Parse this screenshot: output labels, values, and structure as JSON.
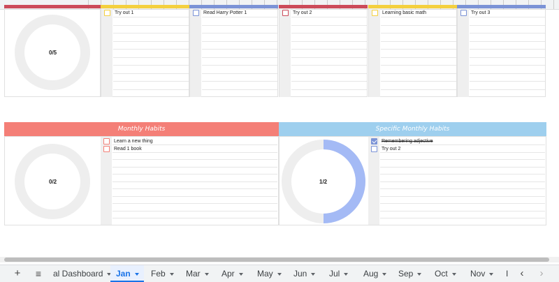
{
  "colors": {
    "red": "#cc4b5a",
    "yellow": "#f4d03f",
    "blue": "#7b93d6",
    "salmon": "#f47f77",
    "lightblue": "#9ecfee",
    "donut_track": "#eeeeee",
    "donut_fill": "#a4baf5"
  },
  "top_section": {
    "progress_label": "0/5",
    "lists": [
      {
        "item": "Try out 1",
        "color": "yellow"
      },
      {
        "item": "Read Harry Potter 1",
        "color": "blue"
      },
      {
        "item": "Try out 2",
        "color": "red"
      },
      {
        "item": "Learning basic math",
        "color": "yellow"
      },
      {
        "item": "Try out 3",
        "color": "blue"
      }
    ]
  },
  "monthly_habits": {
    "title": "Monthly Habits",
    "progress_label": "0/2",
    "progress_value": 0,
    "items": [
      {
        "label": "Learn a new thing",
        "checked": false
      },
      {
        "label": "Read 1 book",
        "checked": false
      }
    ]
  },
  "specific_habits": {
    "title": "Specific Monthly Habits",
    "progress_label": "1/2",
    "progress_value": 0.5,
    "items": [
      {
        "label": "Remembering adjective",
        "checked": true
      },
      {
        "label": "Try out 2",
        "checked": false
      }
    ]
  },
  "tabbar": {
    "add_icon": "plus-icon",
    "menu_icon": "hamburger-menu-icon",
    "tabs": [
      {
        "label": "al Dashboard",
        "active": false
      },
      {
        "label": "Jan",
        "active": true
      },
      {
        "label": "Feb",
        "active": false
      },
      {
        "label": "Mar",
        "active": false
      },
      {
        "label": "Apr",
        "active": false
      },
      {
        "label": "May",
        "active": false
      },
      {
        "label": "Jun",
        "active": false
      },
      {
        "label": "Jul",
        "active": false
      },
      {
        "label": "Aug",
        "active": false
      },
      {
        "label": "Sep",
        "active": false
      },
      {
        "label": "Oct",
        "active": false
      },
      {
        "label": "Nov",
        "active": false
      },
      {
        "label": "I",
        "active": false
      }
    ],
    "scroll_left_icon": "chevron-left-icon",
    "scroll_right_icon": "chevron-right-icon"
  }
}
